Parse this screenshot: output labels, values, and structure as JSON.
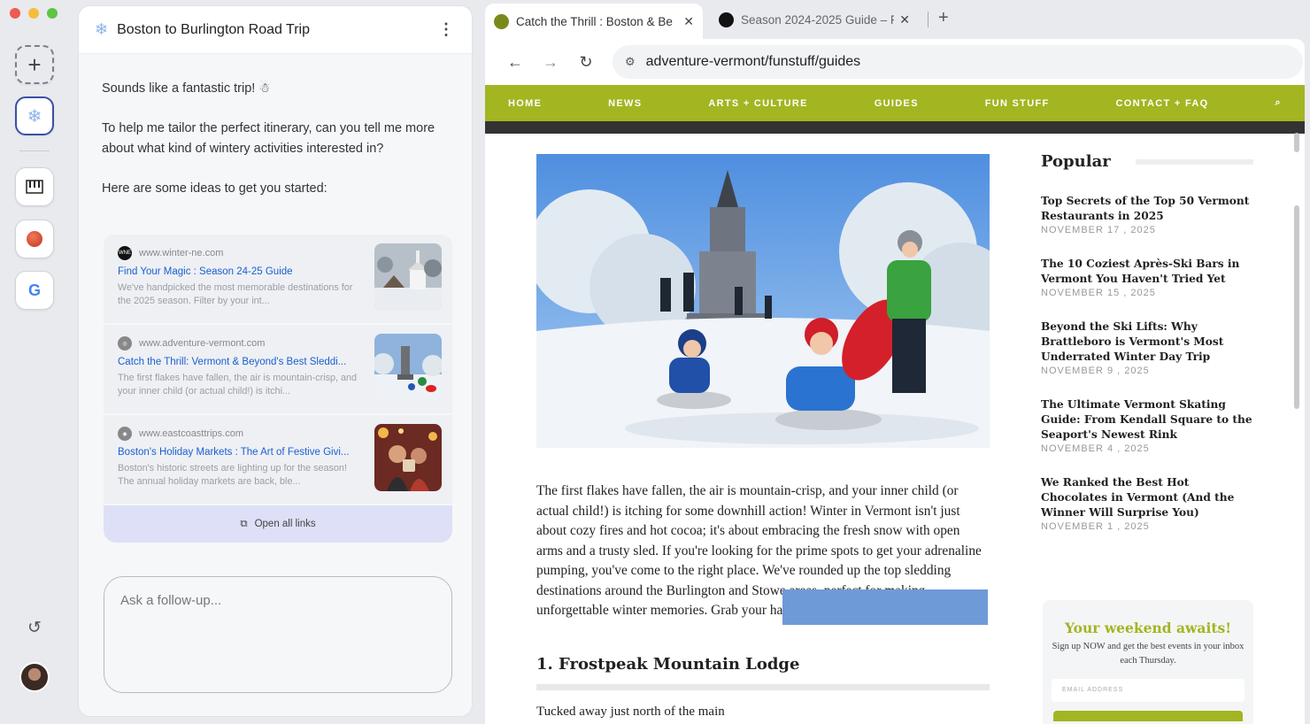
{
  "rail": {
    "new_label": "+"
  },
  "chat": {
    "title": "Boston to Burlington Road Trip",
    "messages": [
      "Sounds like a fantastic trip! ☃",
      "To help me tailor the perfect itinerary, can you tell me more about what kind of wintery activities interested in?",
      "Here are some ideas to get you started:"
    ],
    "cards": [
      {
        "domain": "www.winter-ne.com",
        "link": "Find Your Magic : Season 24-25 Guide",
        "desc": "We've handpicked the most memorable destinations for the 2025 season. Filter by your int..."
      },
      {
        "domain": "www.adventure-vermont.com",
        "link": "Catch the Thrill: Vermont & Beyond's Best Sleddi...",
        "desc": "The first flakes have fallen, the air is mountain-crisp, and your inner child (or actual child!) is itchi..."
      },
      {
        "domain": "www.eastcoasttrips.com",
        "link": "Boston's Holiday Markets : The Art of Festive Givi...",
        "desc": "Boston's historic streets are lighting up for the season! The annual holiday markets are back, ble..."
      }
    ],
    "open_all": "Open all links",
    "followup_placeholder": "Ask a follow-up..."
  },
  "browser": {
    "tabs": [
      {
        "label": "Catch the Thrill : Boston & Be",
        "active": true
      },
      {
        "label": "Season 2024-2025 Guide – F",
        "active": false
      }
    ],
    "url": "adventure-vermont/funstuff/guides"
  },
  "site": {
    "nav": [
      "HOME",
      "NEWS",
      "ARTS + CULTURE",
      "GUIDES",
      "FUN STUFF",
      "CONTACT + FAQ"
    ],
    "body": "The first flakes have fallen, the air is mountain-crisp, and your inner child (or actual child!) is itching for some downhill action! Winter in Vermont isn't just about cozy fires and hot cocoa; it's about embracing the fresh snow with open arms and a trusty sled. If you're looking for the prime spots to get your adrenaline pumping, you've come to the right place. We've rounded up the top sledding destinations around the Burlington and Stowe areas, perfect for making unforgettable winter memories. Grab your hat, gloves, and a fast sled – let's go!",
    "heading1": "1. Frostpeak Mountain Lodge",
    "heading1_body": "Tucked away just north of the main",
    "popular_title": "Popular",
    "popular": [
      {
        "title": "Top Secrets of the Top 50 Vermont Restaurants in  2025",
        "date": "NOVEMBER 17 , 2025"
      },
      {
        "title": "The 10 Coziest Après-Ski Bars in Vermont You Haven't Tried Yet",
        "date": "NOVEMBER 15 , 2025"
      },
      {
        "title": "Beyond the Ski Lifts: Why Brattleboro is Vermont's Most Underrated Winter Day Trip",
        "date": "NOVEMBER 9 , 2025"
      },
      {
        "title": "The Ultimate Vermont Skating Guide: From Kendall Square to the Seaport's Newest Rink",
        "date": "NOVEMBER 4 , 2025"
      },
      {
        "title": "We Ranked the Best Hot Chocolates in Vermont (And the Winner Will Surprise You)",
        "date": "NOVEMBER 1 , 2025"
      }
    ],
    "newsletter": {
      "title": "Your weekend awaits!",
      "sub": "Sign up NOW and get the best events in your inbox each Thursday.",
      "email_placeholder": "EMAIL ADDRESS"
    }
  },
  "colors": {
    "accent": "#a3b521",
    "link": "#1a5fd0",
    "active_border": "#3a4fa8"
  }
}
